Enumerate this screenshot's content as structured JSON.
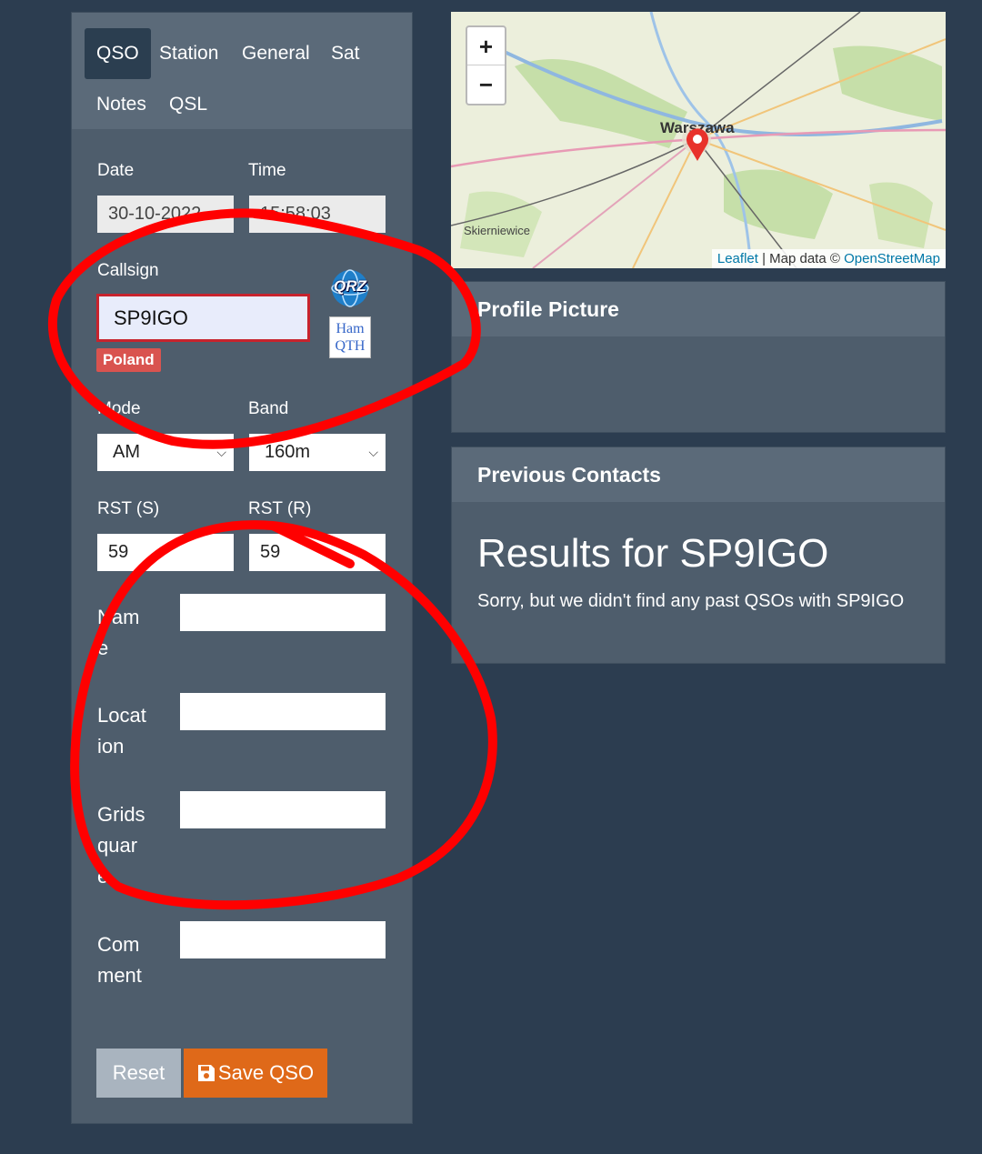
{
  "tabs": [
    "QSO",
    "Station",
    "General",
    "Sat",
    "Notes",
    "QSL"
  ],
  "date": {
    "label": "Date",
    "value": "30-10-2022"
  },
  "time": {
    "label": "Time",
    "value": "15:58:03"
  },
  "callsign": {
    "label": "Callsign",
    "value": "SP9IGO",
    "country": "Poland"
  },
  "icons": {
    "qrz": "qrz-lookup-icon",
    "hamqth": "hamqth-lookup-icon",
    "qrz_text": "QRZ",
    "hamqth_text": "Ham QTH"
  },
  "mode": {
    "label": "Mode",
    "value": "AM"
  },
  "band": {
    "label": "Band",
    "value": "160m"
  },
  "rst_s": {
    "label": "RST (S)",
    "value": "59"
  },
  "rst_r": {
    "label": "RST (R)",
    "value": "59"
  },
  "name": {
    "label": "Name",
    "value": ""
  },
  "location": {
    "label": "Location",
    "value": ""
  },
  "gridsquare": {
    "label": "Gridsquare",
    "value": ""
  },
  "comment": {
    "label": "Comment",
    "value": ""
  },
  "buttons": {
    "reset": "Reset",
    "save": "Save QSO",
    "save_icon": "floppy-disk-icon"
  },
  "map": {
    "zoom_in": "+",
    "zoom_out": "−",
    "city_main": "Warszawa",
    "city_secondary": "Skierniewice",
    "attribution_link1": "Leaflet",
    "attribution_mid": " | Map data © ",
    "attribution_link2": "OpenStreetMap"
  },
  "profile": {
    "header": "Profile Picture"
  },
  "previous": {
    "header": "Previous Contacts",
    "title": "Results for SP9IGO",
    "message": "Sorry, but we didn't find any past QSOs with SP9IGO"
  },
  "colors": {
    "background": "#2c3d50",
    "panel": "#4e5d6c",
    "panel_header": "#5b6a79",
    "save_button": "#df6919",
    "reset_button": "#a9b4bf",
    "badge": "#d9534f",
    "annotation": "#ff0000"
  }
}
